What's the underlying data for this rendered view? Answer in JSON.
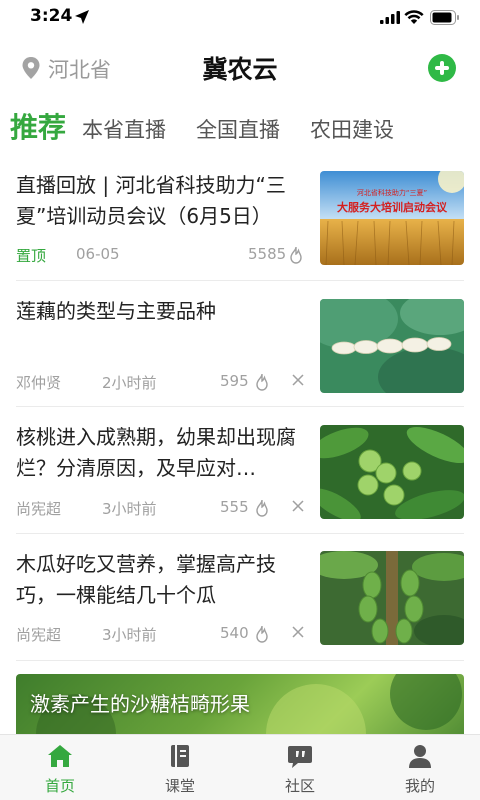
{
  "status_bar": {
    "time": "3:24"
  },
  "header": {
    "region": "河北省",
    "title": "冀农云"
  },
  "tabs": [
    {
      "label": "推荐",
      "active": true
    },
    {
      "label": "本省直播"
    },
    {
      "label": "全国直播"
    },
    {
      "label": "农田建设"
    }
  ],
  "articles": [
    {
      "title": "直播回放 | 河北省科技助力“三夏”培训动员会议（6月5日）",
      "tag": "置顶",
      "date": "06-05",
      "views": "5585"
    },
    {
      "title": "莲藕的类型与主要品种",
      "author": "邓仲贤",
      "time": "2小时前",
      "views": "595"
    },
    {
      "title": "核桃进入成熟期，幼果却出现腐烂？分清原因，及早应对…",
      "author": "尚宪超",
      "time": "3小时前",
      "views": "555"
    },
    {
      "title": "木瓜好吃又营养，掌握高产技巧，一棵能结几十个瓜",
      "author": "尚宪超",
      "time": "3小时前",
      "views": "540"
    }
  ],
  "thumb1": {
    "line1": "河北省科技助力“三夏”",
    "line2": "大服务大培训启动会议"
  },
  "banner": {
    "title": "激素产生的沙糖桔畸形果"
  },
  "nav": [
    {
      "label": "首页",
      "icon": "home-icon",
      "active": true
    },
    {
      "label": "课堂",
      "icon": "book-icon"
    },
    {
      "label": "社区",
      "icon": "chat-icon"
    },
    {
      "label": "我的",
      "icon": "user-icon"
    }
  ],
  "colors": {
    "accent": "#35a83f",
    "add_button": "#2fb946",
    "meta": "#a0a0a0"
  }
}
